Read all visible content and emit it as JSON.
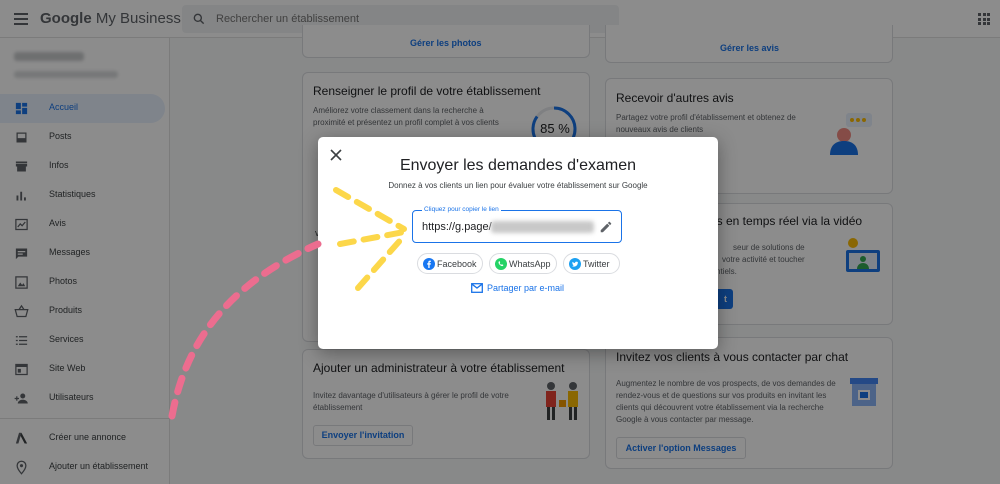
{
  "header": {
    "logo_google": "Google",
    "logo_product": "My Business",
    "search_placeholder": "Rechercher un établissement"
  },
  "sidebar": {
    "items": [
      {
        "label": "Accueil",
        "icon": "dashboard-icon",
        "active": true
      },
      {
        "label": "Posts",
        "icon": "posts-icon"
      },
      {
        "label": "Infos",
        "icon": "store-icon"
      },
      {
        "label": "Statistiques",
        "icon": "bar-chart-icon"
      },
      {
        "label": "Avis",
        "icon": "reviews-icon"
      },
      {
        "label": "Messages",
        "icon": "chat-icon"
      },
      {
        "label": "Photos",
        "icon": "photos-icon"
      },
      {
        "label": "Produits",
        "icon": "basket-icon"
      },
      {
        "label": "Services",
        "icon": "list-icon"
      },
      {
        "label": "Site Web",
        "icon": "website-icon"
      },
      {
        "label": "Utilisateurs",
        "icon": "add-user-icon"
      }
    ],
    "bottom": [
      {
        "label": "Créer une annonce",
        "icon": "google-ads-icon"
      },
      {
        "label": "Ajouter un établissement",
        "icon": "location-pin-icon"
      }
    ]
  },
  "cards": {
    "photos_link": "Gérer les photos",
    "reviews_link": "Gérer les avis",
    "profile": {
      "title": "Renseigner le profil de votre établissement",
      "text": "Améliorez votre classement dans la recherche à proximité et présentez un profil complet à vos clients",
      "progress": "85 %",
      "progress_value": 0.85
    },
    "more_reviews": {
      "title": "Recevoir d'autres avis",
      "text": "Partagez votre profil d'établissement et obtenez de nouveaux avis de clients"
    },
    "video": {
      "title_fragment": "urs en temps réel via la vidéo",
      "text_line1": "seur de solutions de",
      "text_line2": "votre activité et toucher",
      "text_line3": "ntiels.",
      "button_fragment": "t"
    },
    "admin": {
      "title": "Ajouter un administrateur à votre établissement",
      "text": "Invitez davantage d'utilisateurs à gérer le profil de votre établissement",
      "button": "Envoyer l'invitation"
    },
    "chat": {
      "title": "Invitez vos clients à vous contacter par chat",
      "text": "Augmentez le nombre de vos prospects, de vos demandes de rendez-vous et de questions sur vos produits en invitant les clients qui découvrent votre établissement via la recherche Google à vous contacter par message.",
      "button": "Activer l'option Messages"
    },
    "partial_label": "vo"
  },
  "modal": {
    "title": "Envoyer les demandes d'examen",
    "subtitle": "Donnez à vos clients un lien pour évaluer votre établissement sur Google",
    "field_label": "Cliquez pour copier le lien",
    "field_value": "https://g.page/",
    "share": {
      "facebook": "Facebook",
      "whatsapp": "WhatsApp",
      "twitter": "Twitter"
    },
    "email": "Partager par e-mail"
  },
  "colors": {
    "accent": "#1a73e8",
    "arrow_yellow": "#fcd74a",
    "arrow_pink": "#ec6d8f",
    "facebook": "#1877f2",
    "whatsapp": "#25d366",
    "twitter": "#1da1f2"
  }
}
